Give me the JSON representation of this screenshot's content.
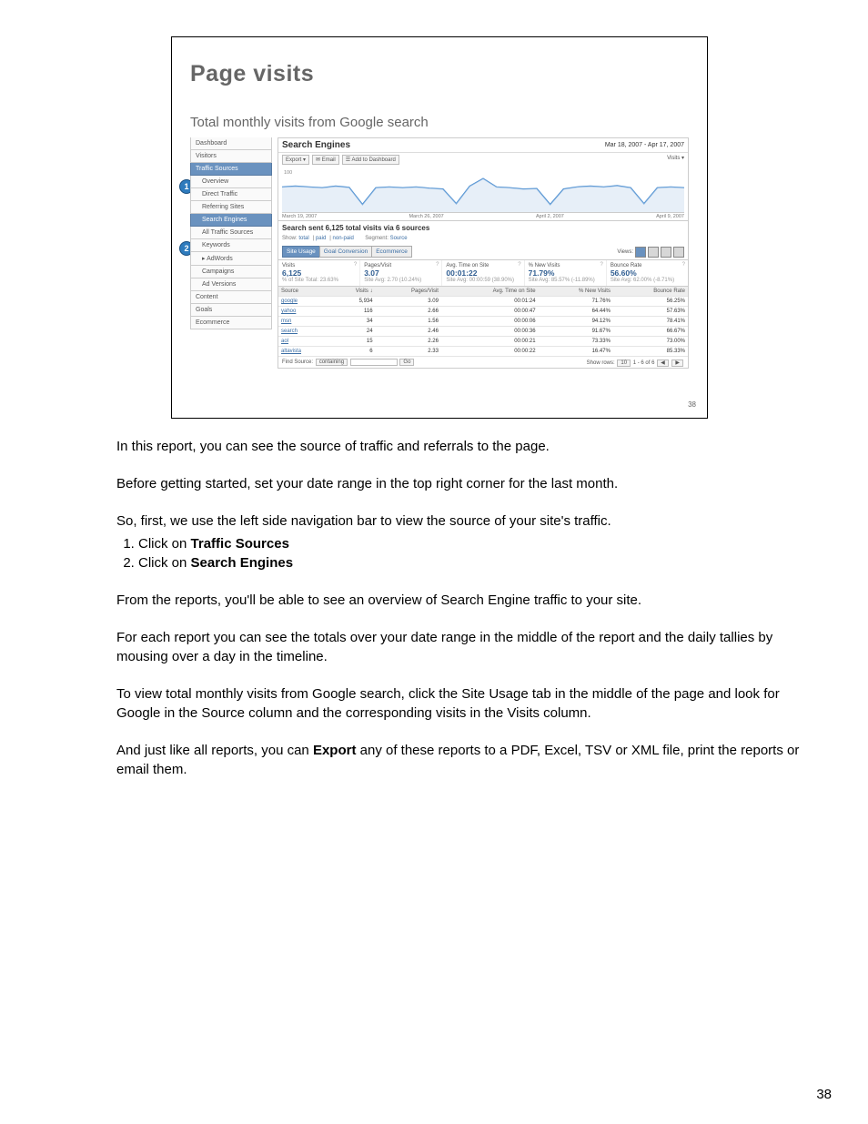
{
  "page_number": "38",
  "shot": {
    "page_number": "38",
    "title": "Page visits",
    "subtitle": "Total monthly visits from Google search",
    "header_title": "Search Engines",
    "date_range": "Mar 18, 2007 - Apr 17, 2007",
    "toolbar": [
      "Export ▾",
      "✉ Email",
      "☰ Add to Dashboard"
    ],
    "scale_right": "Visits ▾",
    "y_label": "100",
    "x_ticks": [
      "March 19, 2007",
      "March 26, 2007",
      "April 2, 2007",
      "April 9, 2007"
    ],
    "sentence": "Search sent 6,125 total visits via 6 sources",
    "seg_labels": {
      "show": "Show:",
      "total": "total",
      "paid": "paid",
      "non_paid": "non-paid",
      "segment": "Segment:",
      "source": "Source"
    },
    "tabs": {
      "site_usage": "Site Usage",
      "goal": "Goal Conversion",
      "ecom": "Ecommerce"
    },
    "views_label": "Views:",
    "metrics": [
      {
        "label": "Visits",
        "value": "6,125",
        "sub": "% of Site Total: 23.63%",
        "red": true
      },
      {
        "label": "Pages/Visit",
        "value": "3.07",
        "sub": "Site Avg:  2.70 (10.24%)"
      },
      {
        "label": "Avg. Time on Site",
        "value": "00:01:22",
        "sub": "Site Avg:  00:00:59 (38.90%)"
      },
      {
        "label": "% New Visits",
        "value": "71.79%",
        "sub": "Site Avg:  85.57% (-11.89%)",
        "redpct": true
      },
      {
        "label": "Bounce Rate",
        "value": "56.60%",
        "sub": "Site Avg:  62.00% (-8.71%)"
      }
    ],
    "columns": [
      "Source",
      "Visits  ↓",
      "Pages/Visit",
      "Avg. Time on Site",
      "% New Visits",
      "Bounce Rate"
    ],
    "rows": [
      {
        "src": "google",
        "v": "5,934",
        "pv": "3.09",
        "t": "00:01:24",
        "nv": "71.76%",
        "br": "56.25%"
      },
      {
        "src": "yahoo",
        "v": "116",
        "pv": "2.66",
        "t": "00:00:47",
        "nv": "64.44%",
        "br": "57.63%"
      },
      {
        "src": "msn",
        "v": "34",
        "pv": "1.56",
        "t": "00:00:06",
        "nv": "94.12%",
        "br": "78.41%"
      },
      {
        "src": "search",
        "v": "24",
        "pv": "2.46",
        "t": "00:00:36",
        "nv": "91.67%",
        "br": "66.67%"
      },
      {
        "src": "aol",
        "v": "15",
        "pv": "2.26",
        "t": "00:00:21",
        "nv": "73.33%",
        "br": "73.00%"
      },
      {
        "src": "altavista",
        "v": "6",
        "pv": "2.33",
        "t": "00:00:22",
        "nv": "16.47%",
        "br": "85.33%"
      }
    ],
    "footer": {
      "find": "Find Source:",
      "sel": "containing",
      "go": "Go",
      "show_rows": "Show rows:",
      "rows_sel": "10",
      "range": "1 - 6 of 6"
    },
    "sidebar": [
      {
        "text": "Dashboard"
      },
      {
        "text": "Visitors"
      },
      {
        "text": "Traffic Sources",
        "selected": true
      },
      {
        "text": "Overview",
        "sub": true
      },
      {
        "text": "Direct Traffic",
        "sub": true
      },
      {
        "text": "Referring Sites",
        "sub": true
      },
      {
        "text": "Search Engines",
        "sub": true,
        "selected": true
      },
      {
        "text": "All Traffic Sources",
        "sub": true
      },
      {
        "text": "Keywords",
        "sub": true
      },
      {
        "text": "▸ AdWords",
        "sub": true
      },
      {
        "text": "Campaigns",
        "sub": true
      },
      {
        "text": "Ad Versions",
        "sub": true
      },
      {
        "text": "Content"
      },
      {
        "text": "Goals"
      },
      {
        "text": "Ecommerce"
      }
    ]
  },
  "chart_data": {
    "type": "line",
    "title": "Visits",
    "ylim": [
      0,
      100
    ],
    "x_ticks": [
      "March 19, 2007",
      "March 26, 2007",
      "April 2, 2007",
      "April 9, 2007"
    ],
    "series": [
      {
        "name": "Visits",
        "values": [
          60,
          62,
          60,
          58,
          62,
          59,
          18,
          58,
          60,
          58,
          60,
          57,
          55,
          20,
          62,
          80,
          60,
          58,
          55,
          56,
          18,
          55,
          60,
          62,
          60,
          63,
          58,
          20,
          58,
          60,
          58
        ]
      }
    ]
  },
  "body": {
    "p1": "In this report, you can see the source of traffic and referrals to the page.",
    "p2": "Before getting started, set your date range in the top right corner for the last month.",
    "p3": "So, first, we use the left side navigation bar to view the source of your site's traffic.",
    "li1a": "Click on ",
    "li1b": "Traffic Sources",
    "li2a": "Click on ",
    "li2b": "Search Engines",
    "p4": "From the reports, you'll be able to see an overview of Search Engine traffic to your site.",
    "p5": "For each report you can see the totals over your date range in the middle of the report and the daily tallies by mousing over a day in the timeline.",
    "p6": "To view total monthly visits from Google search, click the Site Usage tab in the middle of the page and look for Google in the Source column and the corresponding visits in the Visits column.",
    "p7a": "And just like all reports, you can ",
    "p7b": "Export",
    "p7c": " any of these reports to a PDF, Excel, TSV or XML file, print the reports or email them."
  }
}
